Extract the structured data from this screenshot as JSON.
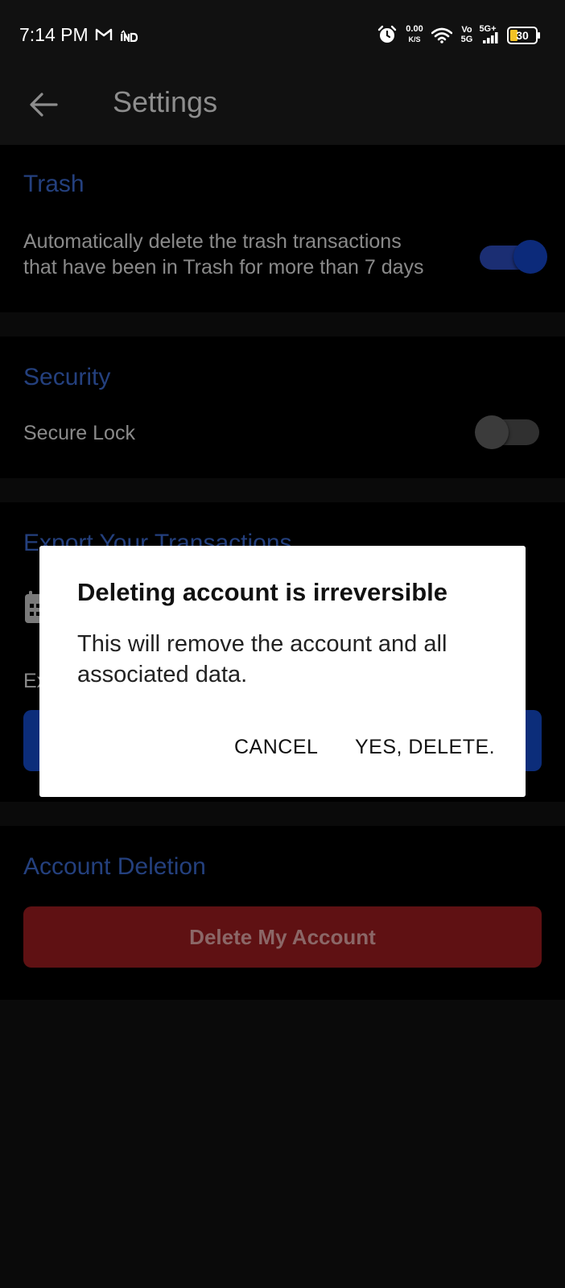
{
  "status_bar": {
    "time": "7:14 PM",
    "app_icons": [
      "gmail-icon",
      "india-news-icon"
    ],
    "network_speed_value": "0.00",
    "network_speed_unit": "K/S",
    "volte_top": "Vo",
    "volte_bottom": "5G",
    "network_type": "5G+",
    "battery_level": "30",
    "icons": [
      "alarm-icon",
      "wifi-icon",
      "signal-icon",
      "battery-icon"
    ]
  },
  "app_bar": {
    "title": "Settings",
    "back_icon": "arrow-left-icon"
  },
  "trash": {
    "title": "Trash",
    "description_line1": "Automatically delete the trash transactions",
    "description_line2": "that have been in Trash for more than 7 days",
    "toggle_on": true
  },
  "security": {
    "title": "Security",
    "secure_lock_label": "Secure Lock",
    "toggle_on": false
  },
  "export": {
    "title": "Export Your Transactions",
    "label_partial": "Ex",
    "icon": "calendar-icon"
  },
  "account_deletion": {
    "title": "Account Deletion",
    "button_label": "Delete My Account"
  },
  "dialog": {
    "title": "Deleting account is irreversible",
    "message": "This will remove the account and all associated data.",
    "cancel_label": "CANCEL",
    "confirm_label": "YES, DELETE."
  },
  "colors": {
    "accent_blue": "#24407e",
    "toggle_blue": "#0c2a7a",
    "danger_red": "#5f1113",
    "background": "#0a0a0a",
    "section_background": "#000000",
    "dialog_background": "#ffffff"
  }
}
